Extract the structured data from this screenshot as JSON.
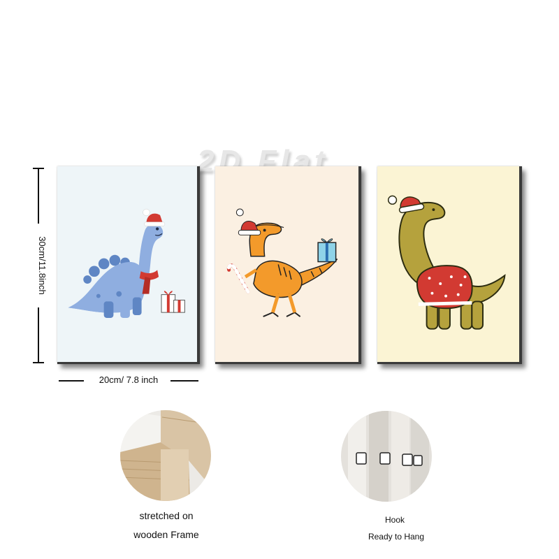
{
  "watermark": "2D Flat",
  "dimensions": {
    "height_label": "30cm/11.8inch",
    "width_label": "20cm/ 7.8 inch"
  },
  "paintings": [
    {
      "name": "blue-dinosaur-santa-hat",
      "background": "#eef5f8",
      "accent": "#8faee0"
    },
    {
      "name": "orange-raptor-candy-cane-gift",
      "background": "#fbf0e2",
      "accent": "#f39a2b"
    },
    {
      "name": "olive-dinosaur-red-sweater",
      "background": "#fbf4d4",
      "accent": "#b5a23d"
    }
  ],
  "features": {
    "frame": {
      "line1": "stretched on",
      "line2": "wooden Frame",
      "icon": "wooden-frame-corner-icon"
    },
    "hook": {
      "line1": "Hook",
      "line2": "Ready to Hang",
      "icon": "hanging-hook-icon"
    }
  }
}
